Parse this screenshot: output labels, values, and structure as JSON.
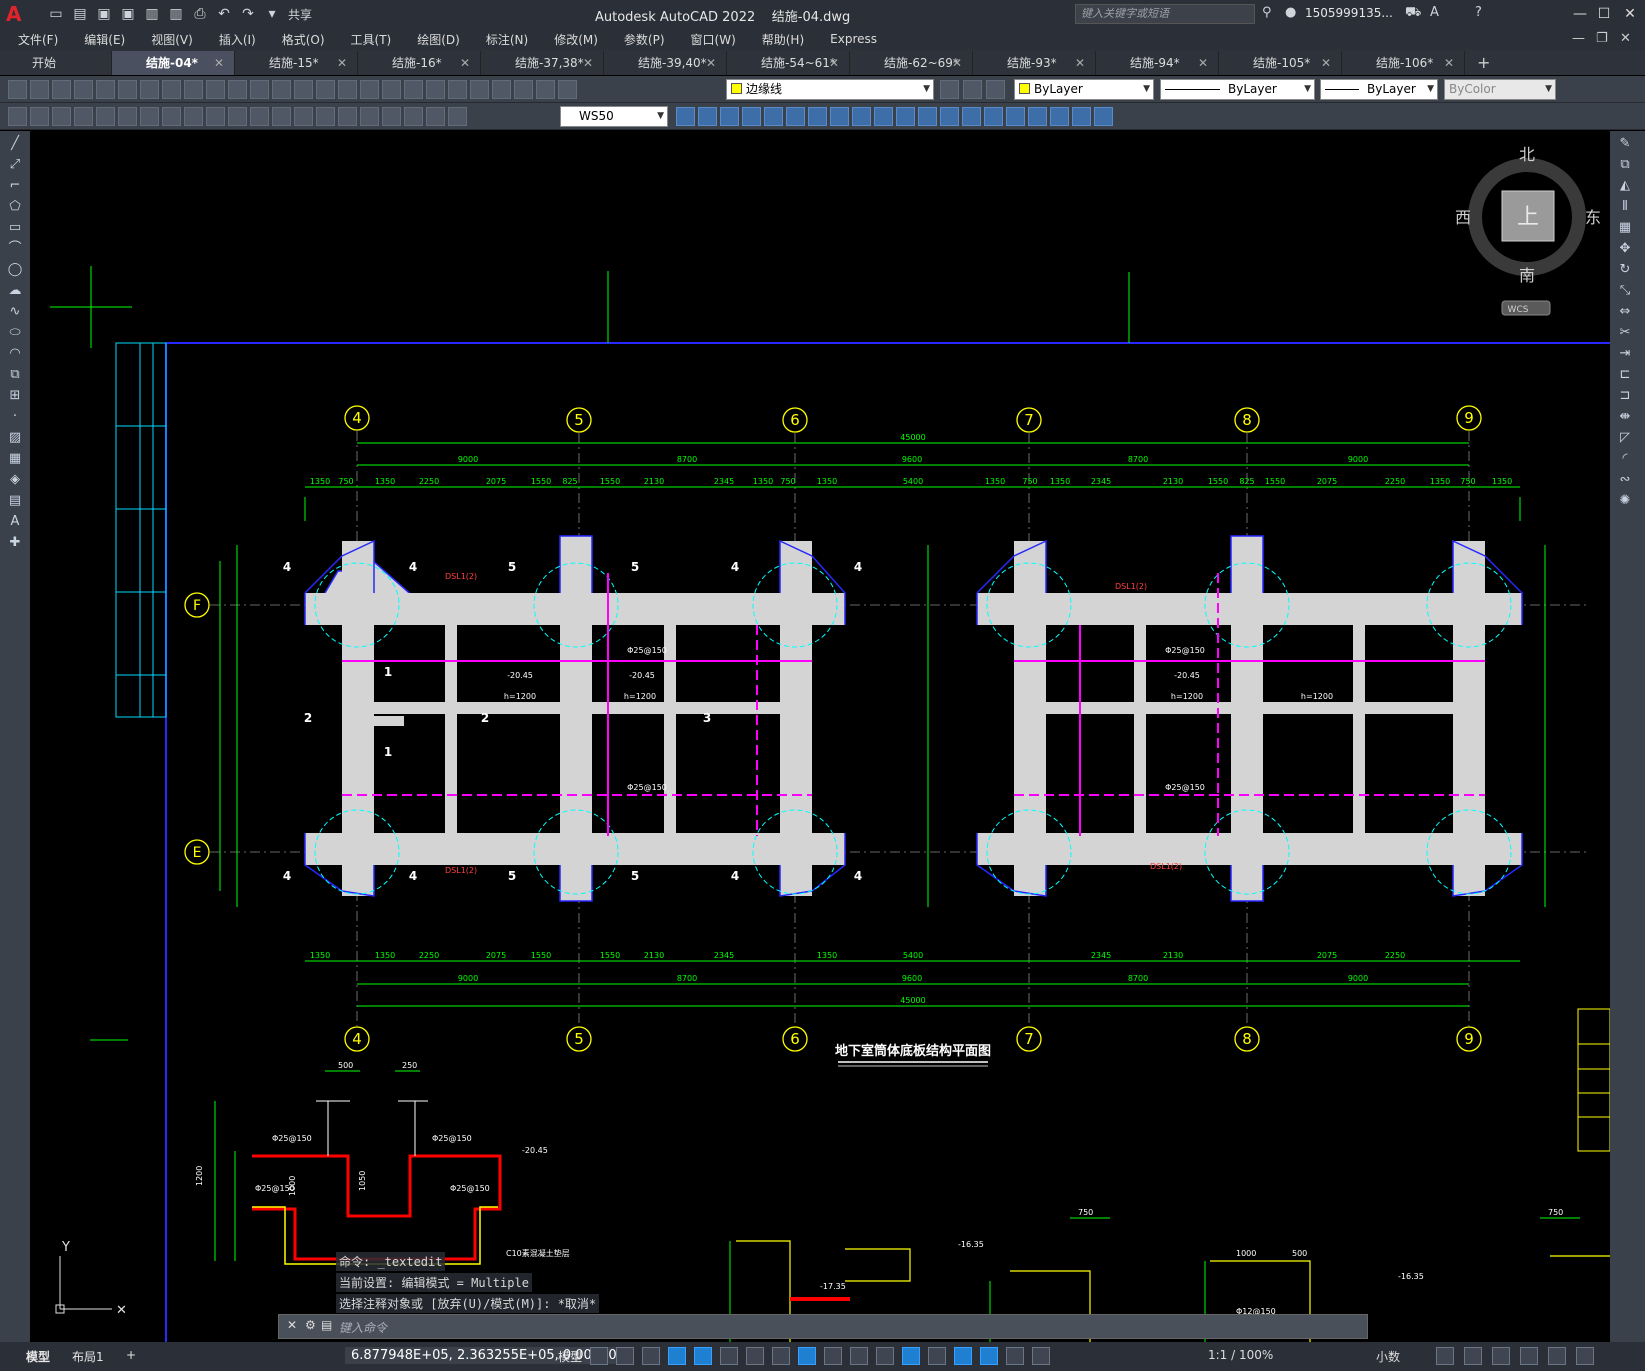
{
  "app": {
    "title": "Autodesk AutoCAD 2022",
    "filename": "结施-04.dwg",
    "share_label": "共享",
    "search_placeholder": "键入关键字或短语",
    "user": "1505999135...",
    "help": "?"
  },
  "menu": [
    "文件(F)",
    "编辑(E)",
    "视图(V)",
    "插入(I)",
    "格式(O)",
    "工具(T)",
    "绘图(D)",
    "标注(N)",
    "修改(M)",
    "参数(P)",
    "窗口(W)",
    "帮助(H)",
    "Express"
  ],
  "tabs": [
    {
      "label": "开始",
      "closable": false,
      "active": false
    },
    {
      "label": "结施-04*",
      "closable": true,
      "active": true
    },
    {
      "label": "结施-15*",
      "closable": true,
      "active": false
    },
    {
      "label": "结施-16*",
      "closable": true,
      "active": false
    },
    {
      "label": "结施-37,38*",
      "closable": true,
      "active": false
    },
    {
      "label": "结施-39,40*",
      "closable": true,
      "active": false
    },
    {
      "label": "结施-54~61*",
      "closable": true,
      "active": false
    },
    {
      "label": "结施-62~69*",
      "closable": true,
      "active": false
    },
    {
      "label": "结施-93*",
      "closable": true,
      "active": false
    },
    {
      "label": "结施-94*",
      "closable": true,
      "active": false
    },
    {
      "label": "结施-105*",
      "closable": true,
      "active": false
    },
    {
      "label": "结施-106*",
      "closable": true,
      "active": false
    }
  ],
  "properties": {
    "layer": "边缘线",
    "color": "ByLayer",
    "linetype": "ByLayer",
    "lineweight": "ByLayer",
    "plotstyle": "ByColor",
    "ucs": "WS50"
  },
  "viewcube": {
    "north": "北",
    "south": "南",
    "east": "东",
    "west": "西",
    "top": "上",
    "wcs": "WCS"
  },
  "drawing": {
    "plan_title": "地下室筒体底板结构平面图",
    "axes_top": [
      "4",
      "5",
      "6",
      "7",
      "8",
      "9"
    ],
    "axes_side": [
      "F",
      "E"
    ],
    "total_dim": "45000",
    "bay_dims": [
      "9000",
      "8700",
      "9600",
      "8700",
      "9000"
    ],
    "sub_dims_left": [
      "1350",
      "750",
      "1350",
      "2250",
      "2075",
      "1550",
      "825",
      "1550",
      "2130",
      "2345",
      "1350",
      "750"
    ],
    "sub_dims_right": [
      "1350",
      "5400",
      "1350",
      "750",
      "1350",
      "2345",
      "2130",
      "1550",
      "825",
      "1550",
      "2075",
      "2250",
      "1350",
      "750",
      "1350"
    ],
    "rebar_labels": [
      "Φ25@150",
      "Φ25@150",
      "Φ25@150",
      "Φ25@150"
    ],
    "elev_labels": [
      "-20.45",
      "-20.45",
      "-20.45"
    ],
    "h_labels": [
      "h=1200",
      "h=1200",
      "h=1200",
      "h=1200"
    ],
    "beam_labels": [
      "DSL1(2)",
      "DSL1(2)",
      "DSL1(2)",
      "DSL1(2)"
    ],
    "section_nums": [
      "4",
      "4",
      "5",
      "5",
      "4",
      "4",
      "1",
      "1",
      "2",
      "2",
      "3"
    ],
    "detail_labels": {
      "d1": "500",
      "d2": "250",
      "d3": "Φ25@150",
      "d4": "Φ25@150",
      "d5": "Φ25@150",
      "d6": "Φ25@150",
      "d7": "1200",
      "d8": "1000",
      "d9": "1050",
      "d10": "C10素混凝土垫层",
      "d11": "-20.45",
      "d12": "-16.35",
      "d13": "-17.35",
      "d14": "750",
      "d15": "1000",
      "d16": "500",
      "d17": "-16.35",
      "d18": "750",
      "d19": "Φ12@150"
    }
  },
  "command": {
    "history": [
      "命令: _textedit",
      "当前设置: 编辑模式 = Multiple",
      "选择注释对象或 [放弃(U)/模式(M)]: *取消*"
    ],
    "placeholder": "键入命令"
  },
  "status": {
    "model_tab": "模型",
    "layout_tab": "布局1",
    "add_tab": "+",
    "coordinates": "6.877948E+05, 2.363255E+05, 0.000000",
    "model_label": "模型",
    "scale": "1:1 / 100%",
    "units": "小数"
  },
  "colors": {
    "dim_green": "#00ff00",
    "slab_fill": "#d4d4d4",
    "border_blue": "#2828ff",
    "axis_yellow": "#ffff00",
    "magenta": "#ff00ff",
    "cyan": "#00ffff",
    "red": "#ff0000"
  }
}
